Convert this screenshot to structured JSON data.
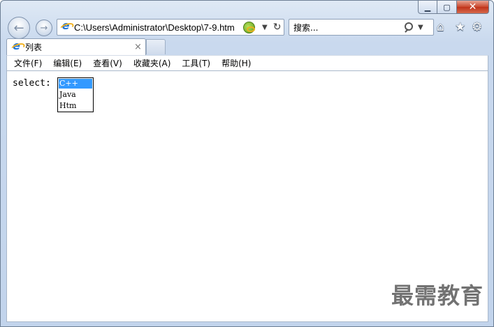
{
  "window": {
    "caption": {
      "minimize": "▁",
      "maximize": "▢",
      "close": "✕"
    }
  },
  "navbar": {
    "back_glyph": "←",
    "forward_glyph": "→",
    "address": "C:\\Users\\Administrator\\Desktop\\7-9.htm",
    "address_dropdown": "▼",
    "refresh_glyph": "↻",
    "search_placeholder": "搜索...",
    "search_dropdown": "▼",
    "toolbar_icons": {
      "home": "⌂",
      "favorites": "★",
      "tools": "⚙"
    }
  },
  "tabs": [
    {
      "label": "列表",
      "active": true,
      "close_glyph": "×"
    }
  ],
  "menubar": {
    "items": [
      "文件(F)",
      "编辑(E)",
      "查看(V)",
      "收藏夹(A)",
      "工具(T)",
      "帮助(H)"
    ]
  },
  "page": {
    "label": "select:",
    "listbox": {
      "options": [
        "C++",
        "Java",
        "Htm"
      ],
      "selected_index": 0
    }
  },
  "watermark": "最需教育",
  "colors": {
    "selection": "#3399ff",
    "close_button": "#c9462c",
    "frame": "#c9d9ee"
  }
}
